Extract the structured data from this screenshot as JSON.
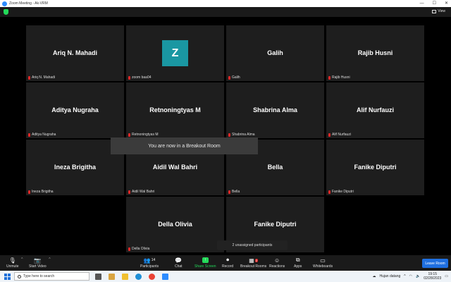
{
  "window": {
    "title": "Zoom Meeting - Ak-VRM"
  },
  "header": {
    "view_label": "View"
  },
  "participants_grid": [
    {
      "name": "Ariq N. Mahadi",
      "tag": "Ariq N. Mahadi",
      "avatar": null
    },
    {
      "name": "",
      "tag": "zoom baa04",
      "avatar": "Z"
    },
    {
      "name": "Galih",
      "tag": "Galih",
      "avatar": null
    },
    {
      "name": "Rajib Husni",
      "tag": "Rajib Husni",
      "avatar": null
    },
    {
      "name": "Aditya Nugraha",
      "tag": "Aditya Nugraha",
      "avatar": null
    },
    {
      "name": "Retnoningtyas M",
      "tag": "Retnoningtyas M",
      "avatar": null
    },
    {
      "name": "Shabrina Alma",
      "tag": "Shabrina Alma",
      "avatar": null
    },
    {
      "name": "Alif Nurfauzi",
      "tag": "Alif Nurfauzi",
      "avatar": null
    },
    {
      "name": "Ineza Brigitha",
      "tag": "Ineza Brigitha",
      "avatar": null
    },
    {
      "name": "Aidil Wal Bahri",
      "tag": "Aidil Wal Bahri",
      "avatar": null
    },
    {
      "name": "Bella",
      "tag": "Bella",
      "avatar": null
    },
    {
      "name": "Fanike Diputri",
      "tag": "Fanike Diputri",
      "avatar": null
    },
    {
      "name": "Della Olivia",
      "tag": "Della Olivia",
      "avatar": null
    },
    {
      "name": "Fanike Diputri",
      "tag": "",
      "avatar": null
    }
  ],
  "notification": {
    "breakout_message": "You are now in a Breakout Room",
    "unassigned": "2 unassigned participants"
  },
  "toolbar": {
    "unmute": "Unmute",
    "start_video": "Start Video",
    "participants": "Participants",
    "participants_count": "14",
    "chat": "Chat",
    "share_screen": "Share Screen",
    "record": "Record",
    "breakout_rooms": "Breakout Rooms",
    "breakout_badge": "2",
    "reactions": "Reactions",
    "apps": "Apps",
    "whiteboards": "Whiteboards",
    "leave_room": "Leave Room"
  },
  "taskbar": {
    "search_placeholder": "Type here to search",
    "weather": "Hujan datang",
    "time": "19:15",
    "date": "02/28/2023"
  },
  "colors": {
    "accent": "#2D8CFF",
    "share_green": "#23D959",
    "mute_red": "#e02828",
    "avatar_teal": "#1a97a2",
    "leave_blue": "#1f6fe0"
  }
}
